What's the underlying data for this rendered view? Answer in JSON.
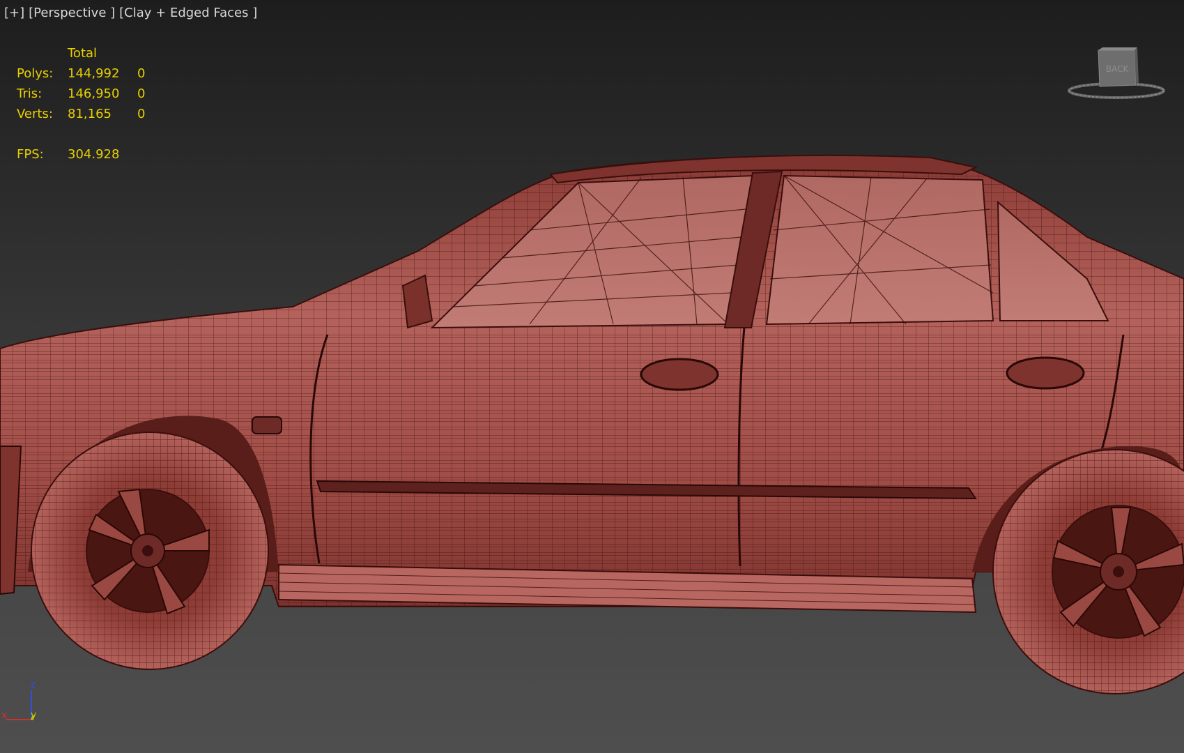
{
  "viewport": {
    "label_plus": "[+]",
    "label_view": "[Perspective ]",
    "label_shading": "[Clay + Edged Faces ]"
  },
  "stats": {
    "header": "Total",
    "polys_label": "Polys:",
    "polys_total": "144,992",
    "polys_sel": "0",
    "tris_label": "Tris:",
    "tris_total": "146,950",
    "tris_sel": "0",
    "verts_label": "Verts:",
    "verts_total": "81,165",
    "verts_sel": "0",
    "fps_label": "FPS:",
    "fps_value": "304.928"
  },
  "viewcube": {
    "face_label": "BACK"
  },
  "axes": {
    "x": "x",
    "y": "y",
    "z": "z"
  },
  "colors": {
    "stats_text": "#e8d000",
    "model_fill": "#a8524c",
    "wire": "#3a0e0c",
    "axis_x": "#d03030",
    "axis_y": "#c8c800",
    "axis_z": "#3050e0"
  }
}
